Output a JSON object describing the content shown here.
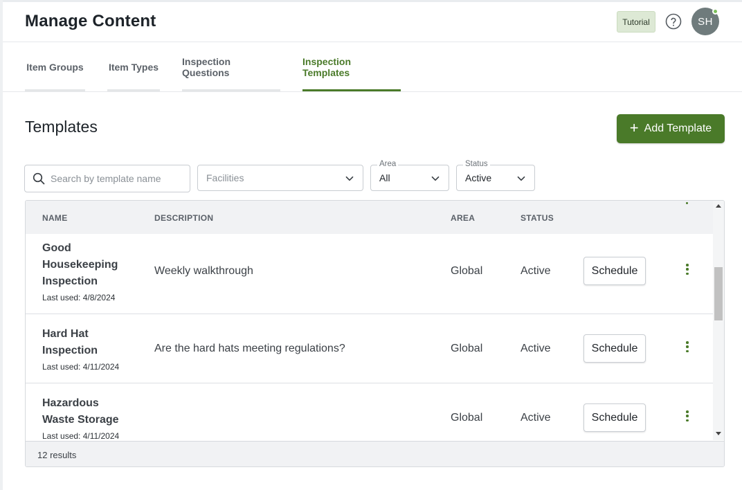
{
  "header": {
    "title": "Manage Content",
    "tutorial_label": "Tutorial",
    "avatar_initials": "SH"
  },
  "tabs": [
    {
      "label": "Item Groups",
      "active": false
    },
    {
      "label": "Item Types",
      "active": false
    },
    {
      "label": "Inspection Questions",
      "active": false
    },
    {
      "label": "Inspection Templates",
      "active": true
    }
  ],
  "section": {
    "title": "Templates",
    "add_button_label": "Add Template"
  },
  "filters": {
    "search_placeholder": "Search by template name",
    "facilities_placeholder": "Facilities",
    "area_label": "Area",
    "area_value": "All",
    "status_label": "Status",
    "status_value": "Active"
  },
  "table": {
    "columns": {
      "name": "NAME",
      "description": "DESCRIPTION",
      "area": "AREA",
      "status": "STATUS"
    },
    "rows": [
      {
        "name": "Good Housekeeping Inspection",
        "last_used": "Last used: 4/8/2024",
        "description": "Weekly walkthrough",
        "area": "Global",
        "status": "Active",
        "action_label": "Schedule"
      },
      {
        "name": "Hard Hat Inspection",
        "last_used": "Last used: 4/11/2024",
        "description": "Are the hard hats meeting regulations?",
        "area": "Global",
        "status": "Active",
        "action_label": "Schedule"
      },
      {
        "name": "Hazardous Waste Storage",
        "last_used": "Last used: 4/11/2024",
        "description": "",
        "area": "Global",
        "status": "Active",
        "action_label": "Schedule"
      }
    ],
    "results_text": "12 results"
  },
  "colors": {
    "brand_green": "#4a7a29",
    "tutorial_bg": "#dde9d5",
    "avatar_bg": "#6f7b7c",
    "online_dot": "#7bbf5a"
  }
}
